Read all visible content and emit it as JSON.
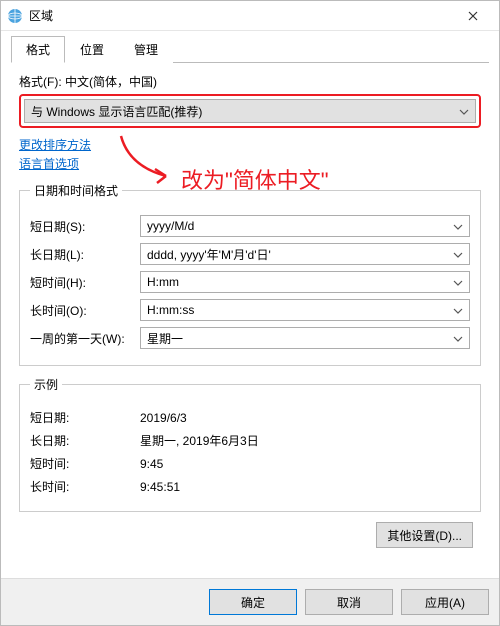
{
  "titlebar": {
    "title": "区域"
  },
  "tabs": {
    "format": "格式",
    "location": "位置",
    "admin": "管理"
  },
  "format_label": "格式(F): 中文(简体，中国)",
  "format_select": "与 Windows 显示语言匹配(推荐)",
  "links": {
    "sort": "更改排序方法",
    "lang": "语言首选项"
  },
  "annotation_text": "改为\"简体中文\"",
  "dt_fieldset_legend": "日期和时间格式",
  "dt": {
    "short_date_label": "短日期(S):",
    "short_date_value": "yyyy/M/d",
    "long_date_label": "长日期(L):",
    "long_date_value": "dddd, yyyy'年'M'月'd'日'",
    "short_time_label": "短时间(H):",
    "short_time_value": "H:mm",
    "long_time_label": "长时间(O):",
    "long_time_value": "H:mm:ss",
    "first_day_label": "一周的第一天(W):",
    "first_day_value": "星期一"
  },
  "example_legend": "示例",
  "example": {
    "short_date_label": "短日期:",
    "short_date_value": "2019/6/3",
    "long_date_label": "长日期:",
    "long_date_value": "星期一, 2019年6月3日",
    "short_time_label": "短时间:",
    "short_time_value": "9:45",
    "long_time_label": "长时间:",
    "long_time_value": "9:45:51"
  },
  "buttons": {
    "other_settings": "其他设置(D)...",
    "ok": "确定",
    "cancel": "取消",
    "apply": "应用(A)"
  }
}
